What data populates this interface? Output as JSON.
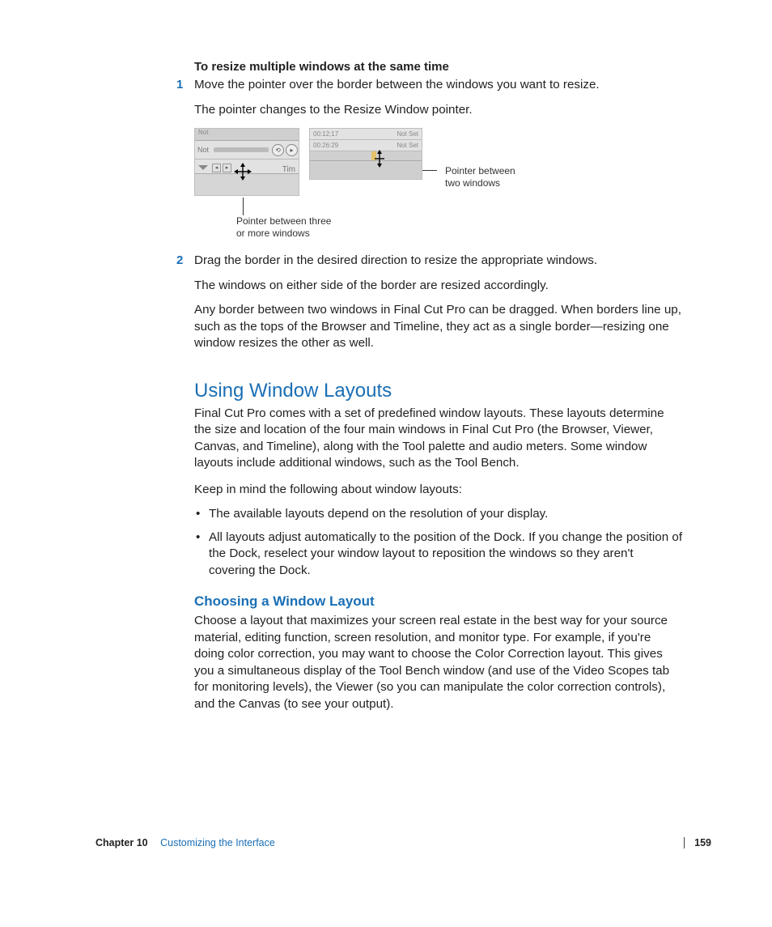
{
  "header": "To resize multiple windows at the same time",
  "step1": {
    "n": "1",
    "line": "Move the pointer over the border between the windows you want to resize.",
    "follow": "The pointer changes to the Resize Window pointer."
  },
  "figure": {
    "callout_right_l1": "Pointer between",
    "callout_right_l2": "two windows",
    "callout_bottom_l1": "Pointer between three",
    "callout_bottom_l2": "or more windows",
    "shot1_top": "Not",
    "shot1_not": "Not",
    "shot1_tim": "Tim",
    "tc1": "00:12;17",
    "tc2": "Not Set",
    "tc3": "00:26:29",
    "tc4": "Not Set"
  },
  "step2": {
    "n": "2",
    "line": "Drag the border in the desired direction to resize the appropriate windows.",
    "follow": "The windows on either side of the border are resized accordingly.",
    "para": "Any border between two windows in Final Cut Pro can be dragged. When borders line up, such as the tops of the Browser and Timeline, they act as a single border—resizing one window resizes the other as well."
  },
  "section": {
    "title": "Using Window Layouts",
    "intro": "Final Cut Pro comes with a set of predefined window layouts. These layouts determine the size and location of the four main windows in Final Cut Pro (the Browser, Viewer, Canvas, and Timeline), along with the Tool palette and audio meters. Some window layouts include additional windows, such as the Tool Bench.",
    "keep": "Keep in mind the following about window layouts:",
    "b1": "The available layouts depend on the resolution of your display.",
    "b2": "All layouts adjust automatically to the position of the Dock. If you change the position of the Dock, reselect your window layout to reposition the windows so they aren't covering the Dock.",
    "subtitle": "Choosing a Window Layout",
    "subpara": "Choose a layout that maximizes your screen real estate in the best way for your source material, editing function, screen resolution, and monitor type. For example, if you're doing color correction, you may want to choose the Color Correction layout. This gives you a simultaneous display of the Tool Bench window (and use of the Video Scopes tab for monitoring levels), the Viewer (so you can manipulate the color correction controls), and the Canvas (to see your output)."
  },
  "footer": {
    "chapter": "Chapter 10",
    "title": "Customizing the Interface",
    "page": "159"
  }
}
